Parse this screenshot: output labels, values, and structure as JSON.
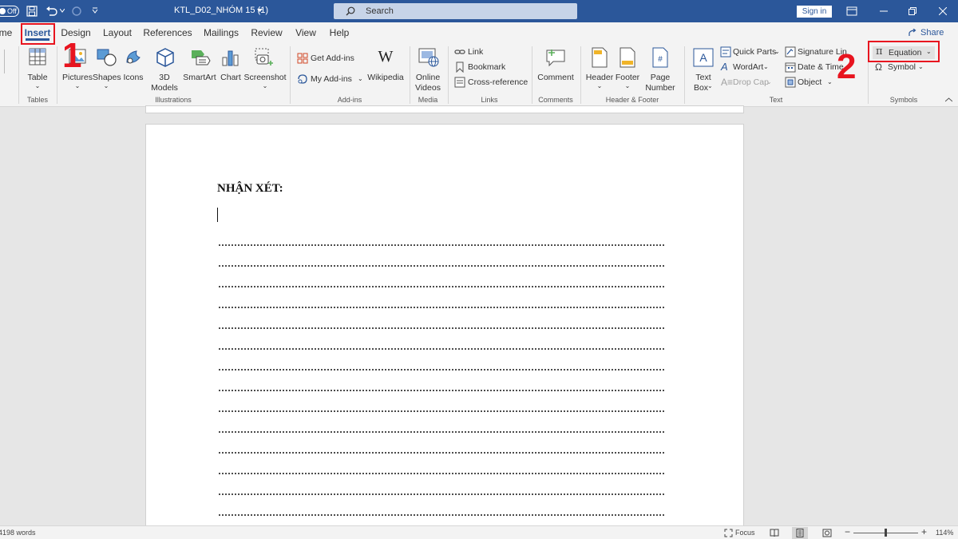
{
  "titlebar": {
    "autosave": "Off",
    "document_title": "KTL_D02_NHÓM 15 (1)",
    "search_placeholder": "Search",
    "sign_in": "Sign in"
  },
  "tabs": [
    {
      "label": "me"
    },
    {
      "label": "Insert"
    },
    {
      "label": "Design"
    },
    {
      "label": "Layout"
    },
    {
      "label": "References"
    },
    {
      "label": "Mailings"
    },
    {
      "label": "Review"
    },
    {
      "label": "View"
    },
    {
      "label": "Help"
    }
  ],
  "share_label": "Share",
  "ribbon": {
    "tables": {
      "table": "Table",
      "group": "Tables"
    },
    "illustrations": {
      "pictures": "Pictures",
      "shapes": "Shapes",
      "icons": "Icons",
      "models_1": "3D",
      "models_2": "Models",
      "smartart": "SmartArt",
      "chart": "Chart",
      "screenshot": "Screenshot",
      "group": "Illustrations"
    },
    "addins": {
      "get": "Get Add-ins",
      "my": "My Add-ins",
      "wikipedia": "Wikipedia",
      "group": "Add-ins"
    },
    "media": {
      "video_1": "Online",
      "video_2": "Videos",
      "group": "Media"
    },
    "links": {
      "link": "Link",
      "bookmark": "Bookmark",
      "crossref": "Cross-reference",
      "group": "Links"
    },
    "comments": {
      "comment": "Comment",
      "group": "Comments"
    },
    "headerfooter": {
      "header": "Header",
      "footer": "Footer",
      "pagenum_1": "Page",
      "pagenum_2": "Number",
      "group": "Header & Footer"
    },
    "text": {
      "textbox_1": "Text",
      "textbox_2": "Box",
      "quickparts": "Quick Parts",
      "wordart": "WordArt",
      "dropcap": "Drop Cap",
      "signature": "Signature Lin",
      "datetime": "Date & Time",
      "object": "Object",
      "group": "Text"
    },
    "symbols": {
      "equation": "Equation",
      "symbol": "Symbol",
      "group": "Symbols"
    }
  },
  "document": {
    "heading": "NHẬN XÉT:"
  },
  "status": {
    "words": "4198 words",
    "focus": "Focus",
    "zoom": "114%"
  },
  "annotations": {
    "step1": "1",
    "step2": "2"
  },
  "colors": {
    "titlebar": "#2b579a",
    "accent": "#2b579a",
    "annotation": "#e8141f"
  }
}
